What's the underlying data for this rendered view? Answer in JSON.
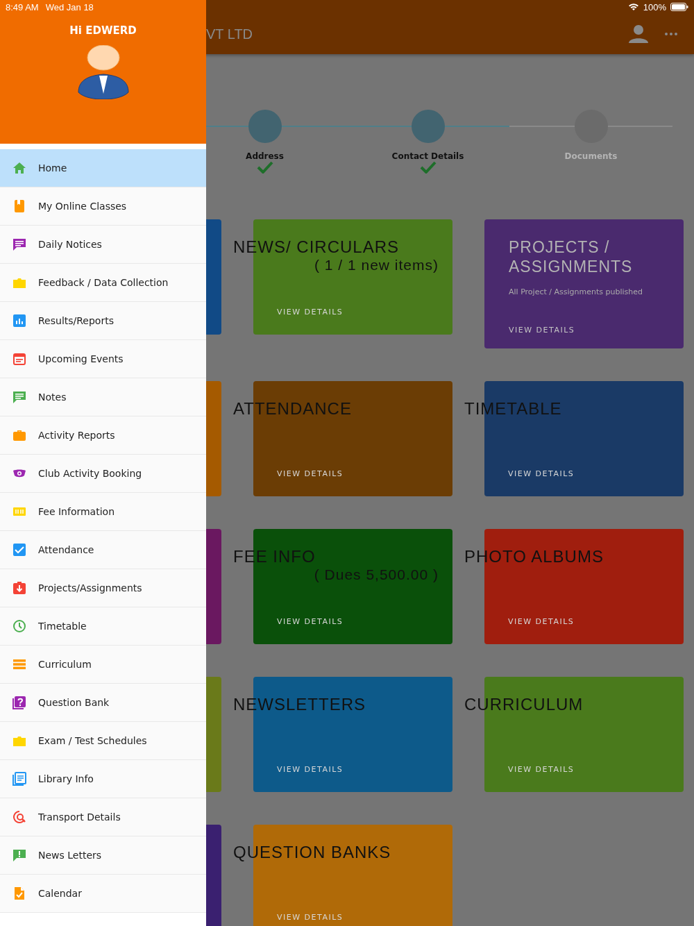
{
  "status_bar": {
    "time": "8:49 AM",
    "date": "Wed Jan 18",
    "battery": "100%"
  },
  "app_bar": {
    "title": "VT LTD"
  },
  "drawer": {
    "greeting": "Hi EDWERD",
    "items": [
      {
        "label": "Home",
        "kind": "house",
        "color": "#4caf50",
        "selected": true
      },
      {
        "label": "My Online Classes",
        "kind": "bookmark",
        "color": "#ff9800",
        "selected": false
      },
      {
        "label": "Daily Notices",
        "kind": "chat",
        "color": "#9c27b0",
        "selected": false
      },
      {
        "label": "Feedback / Data Collection",
        "kind": "folder",
        "color": "#ffd600",
        "selected": false
      },
      {
        "label": "Results/Reports",
        "kind": "chart",
        "color": "#2196f3",
        "selected": false
      },
      {
        "label": "Upcoming Events",
        "kind": "calendar",
        "color": "#f44336",
        "selected": false
      },
      {
        "label": "Notes",
        "kind": "chat",
        "color": "#4caf50",
        "selected": false
      },
      {
        "label": "Activity Reports",
        "kind": "briefcase",
        "color": "#ff9800",
        "selected": false
      },
      {
        "label": "Club Activity Booking",
        "kind": "eye",
        "color": "#9c27b0",
        "selected": false
      },
      {
        "label": "Fee Information",
        "kind": "ticket",
        "color": "#ffd600",
        "selected": false
      },
      {
        "label": "Attendance",
        "kind": "checkbox",
        "color": "#2196f3",
        "selected": false
      },
      {
        "label": "Projects/Assignments",
        "kind": "download",
        "color": "#f44336",
        "selected": false
      },
      {
        "label": "Timetable",
        "kind": "clock",
        "color": "#4caf50",
        "selected": false
      },
      {
        "label": "Curriculum",
        "kind": "list",
        "color": "#ff9800",
        "selected": false
      },
      {
        "label": "Question Bank",
        "kind": "question",
        "color": "#9c27b0",
        "selected": false
      },
      {
        "label": "Exam / Test Schedules",
        "kind": "folder",
        "color": "#ffd600",
        "selected": false
      },
      {
        "label": "Library Info",
        "kind": "book",
        "color": "#2196f3",
        "selected": false
      },
      {
        "label": "Transport Details",
        "kind": "search",
        "color": "#f44336",
        "selected": false
      },
      {
        "label": "News Letters",
        "kind": "alert",
        "color": "#4caf50",
        "selected": false
      },
      {
        "label": "Calendar",
        "kind": "doccheck",
        "color": "#ff9800",
        "selected": false
      }
    ]
  },
  "stepper": [
    {
      "label": "Address",
      "done": true
    },
    {
      "label": "Contact Details",
      "done": true
    },
    {
      "label": "Documents",
      "done": false
    }
  ],
  "cards": [
    {
      "kind": "hidden",
      "color": "#114a86"
    },
    {
      "kind": "tile",
      "title": "NEWS/ CIRCULARS",
      "note": "( 1 / 1 new items)",
      "action": "VIEW DETAILS",
      "color": "#4a7a1c"
    },
    {
      "kind": "feature",
      "title": "PROJECTS / ASSIGNMENTS",
      "description": "All Project / Assignments published",
      "action": "VIEW DETAILS",
      "color": "#4a2a6e"
    },
    {
      "kind": "hidden",
      "color": "#a55a00"
    },
    {
      "kind": "tile",
      "title": "ATTENDANCE",
      "action": "VIEW DETAILS",
      "color": "#6b3d05"
    },
    {
      "kind": "tile",
      "title": "TIMETABLE",
      "action": "VIEW DETAILS",
      "color": "#1a3a66"
    },
    {
      "kind": "hidden",
      "color": "#6a1860"
    },
    {
      "kind": "tile",
      "title": "FEE INFO",
      "note": "( Dues 5,500.00 )",
      "action": "VIEW DETAILS",
      "color": "#0a500a"
    },
    {
      "kind": "tile",
      "title": "PHOTO ALBUMS",
      "action": "VIEW DETAILS",
      "color": "#a01e0e"
    },
    {
      "kind": "hidden",
      "color": "#6a7a1a"
    },
    {
      "kind": "tile",
      "title": "NEWSLETTERS",
      "action": "VIEW DETAILS",
      "color": "#0d5a8a"
    },
    {
      "kind": "tile",
      "title": "CURRICULUM",
      "action": "VIEW DETAILS",
      "color": "#4a7a1c"
    },
    {
      "kind": "hidden",
      "color": "#3a2070"
    },
    {
      "kind": "tile",
      "title": "QUESTION BANKS",
      "action": "VIEW DETAILS",
      "color": "#b06a08"
    }
  ]
}
